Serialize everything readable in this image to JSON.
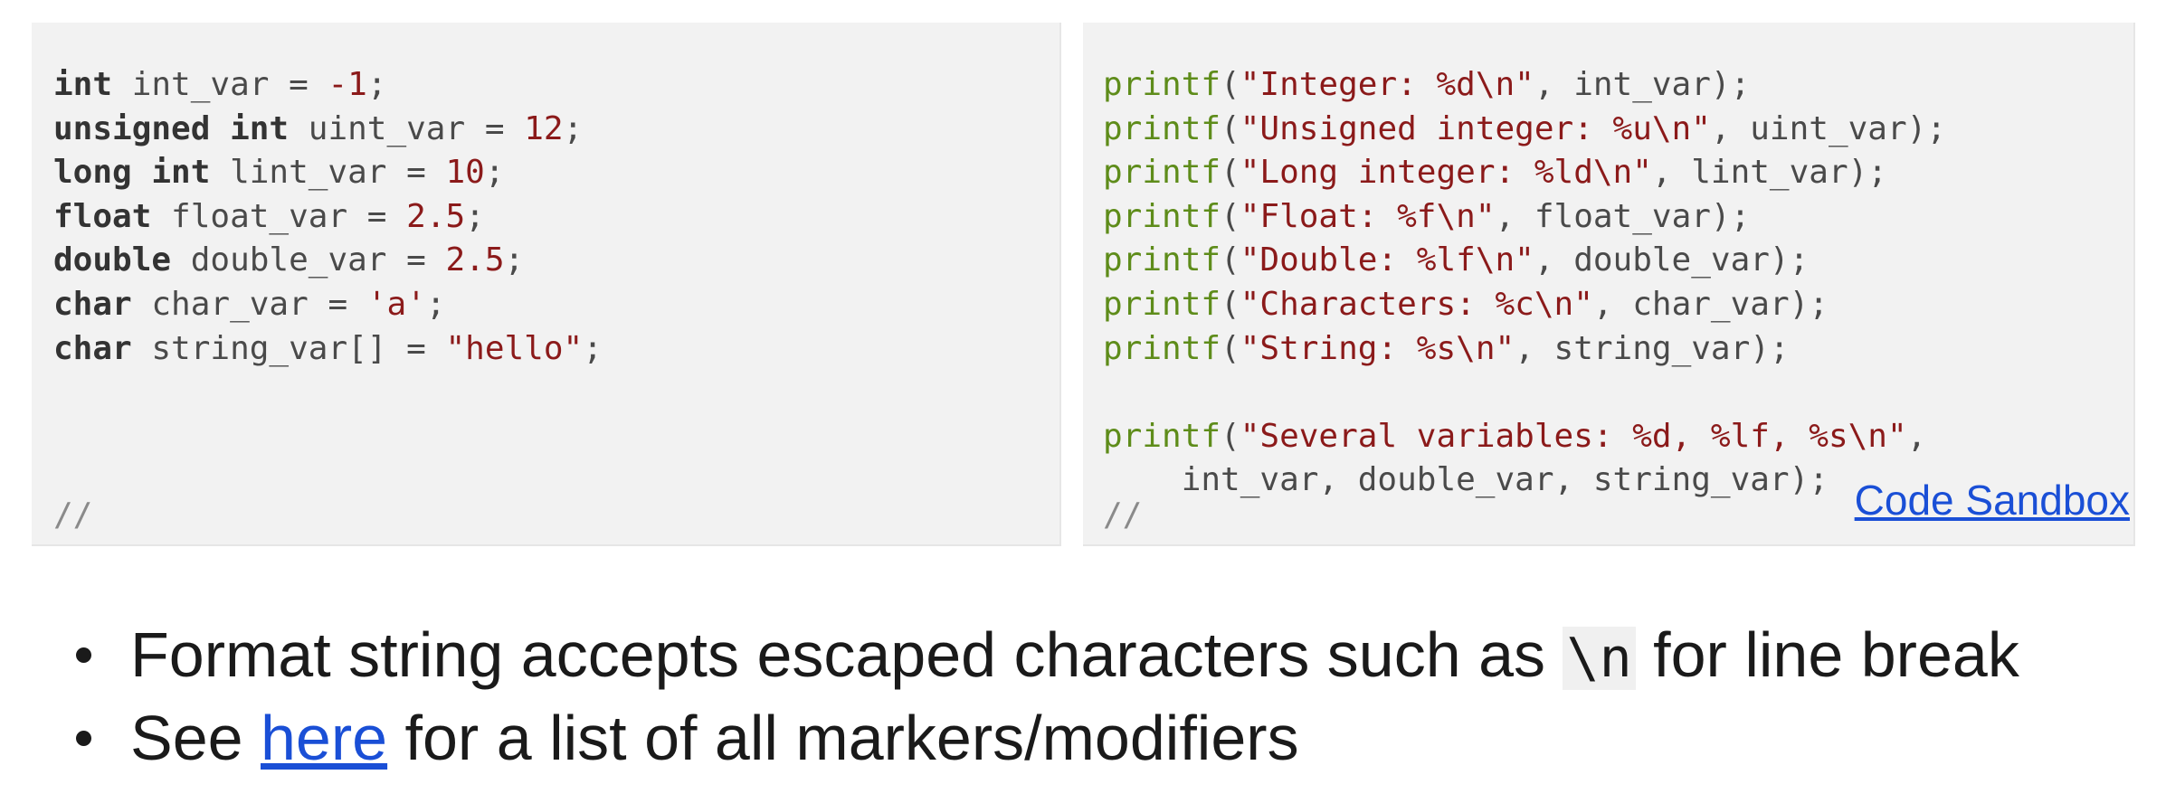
{
  "left_panel": {
    "lines": [
      [
        "int",
        " int_var = ",
        "-1",
        ";"
      ],
      [
        "unsigned int",
        " uint_var = ",
        "12",
        ";"
      ],
      [
        "long int",
        " lint_var = ",
        "10",
        ";"
      ],
      [
        "float",
        " float_var = ",
        "2.5",
        ";"
      ],
      [
        "double",
        " double_var = ",
        "2.5",
        ";"
      ],
      [
        "char",
        " char_var = ",
        "'a'",
        ";"
      ],
      [
        "char",
        " string_var[] = ",
        "\"hello\"",
        ";"
      ]
    ],
    "comment": "//"
  },
  "right_panel": {
    "lines": [
      [
        "printf",
        "(",
        "\"Integer: %d\\n\"",
        ", int_var);"
      ],
      [
        "printf",
        "(",
        "\"Unsigned integer: %u\\n\"",
        ", uint_var);"
      ],
      [
        "printf",
        "(",
        "\"Long integer: %ld\\n\"",
        ", lint_var);"
      ],
      [
        "printf",
        "(",
        "\"Float: %f\\n\"",
        ", float_var);"
      ],
      [
        "printf",
        "(",
        "\"Double: %lf\\n\"",
        ", double_var);"
      ],
      [
        "printf",
        "(",
        "\"Characters: %c\\n\"",
        ", char_var);"
      ],
      [
        "printf",
        "(",
        "\"String: %s\\n\"",
        ", string_var);"
      ],
      [
        "",
        "",
        "",
        ""
      ],
      [
        "printf",
        "(",
        "\"Several variables: %d, %lf, %s\\n\"",
        ","
      ],
      [
        "",
        "",
        "",
        "    int_var, double_var, string_var);"
      ]
    ],
    "comment": "//",
    "sandbox_link": "Code Sandbox"
  },
  "bullets": {
    "item1_before": "Format string accepts escaped characters such as ",
    "item1_code": "\\n",
    "item1_after": " for line break",
    "item2_before": "See ",
    "item2_link": "here",
    "item2_after": " for a list of all markers/modifiers"
  }
}
